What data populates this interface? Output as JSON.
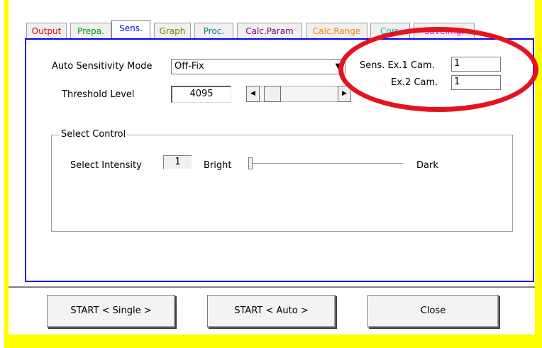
{
  "tabs": [
    {
      "label": "Output",
      "color": "#e00000"
    },
    {
      "label": "Prepa.",
      "color": "#00a000"
    },
    {
      "label": "Sens.",
      "color": "#0000ff",
      "active": true
    },
    {
      "label": "Graph",
      "color": "#808000"
    },
    {
      "label": "Proc.",
      "color": "#008080"
    },
    {
      "label": "Calc.Param",
      "color": "#800080"
    },
    {
      "label": "Calc.Range",
      "color": "#ff8000"
    },
    {
      "label": "Corr.",
      "color": "#00c0c0"
    },
    {
      "label": "SaveImg.",
      "color": "#ff00ff"
    }
  ],
  "sens": {
    "auto_mode_label": "Auto Sensitivity Mode",
    "auto_mode_value": "Off-Fix",
    "threshold_label": "Threshold Level",
    "threshold_value": "4095",
    "threshold_scroll_fraction": 0.02,
    "ex1_label": "Sens. Ex.1 Cam.",
    "ex1_value": "1",
    "ex2_label": "Ex.2 Cam.",
    "ex2_value": "1"
  },
  "select_control": {
    "legend": "Select Control",
    "intensity_label": "Select Intensity",
    "intensity_value": "1",
    "bright_label": "Bright",
    "dark_label": "Dark",
    "slider_fraction": 0.0
  },
  "buttons": {
    "start_single": "START < Single >",
    "start_auto": "START < Auto >",
    "close": "Close"
  },
  "colors": {
    "frame": "#ffff00",
    "panel_border": "#0000ff",
    "annotation": "#e5131f"
  }
}
